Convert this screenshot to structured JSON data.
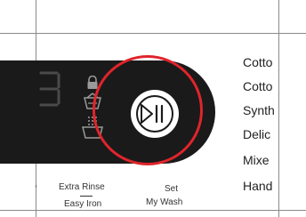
{
  "programs": [
    "Cotto",
    "Cotto",
    "Synth",
    "Delic",
    "Mixe",
    "Hand"
  ],
  "labels": {
    "extra_rinse": "Extra Rinse",
    "easy_iron": "Easy Iron",
    "set": "Set",
    "my_wash": "My Wash"
  },
  "display": {
    "digit": "3"
  },
  "icons": {
    "lock": "lock-icon",
    "basket": "basket-icon",
    "rinse": "rinse-icon",
    "play_pause": "play-pause-icon"
  },
  "colors": {
    "panel": "#1a1a1a",
    "highlight": "#e0242b",
    "button": "#ffffff"
  }
}
